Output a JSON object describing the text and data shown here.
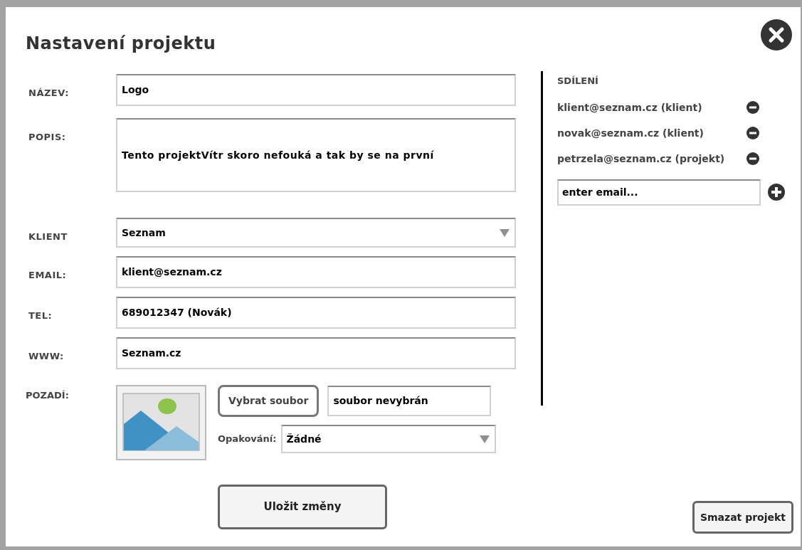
{
  "window": {
    "title": "Nastavení projektu"
  },
  "fields": [
    {
      "label": "NÁZEV:",
      "value": "Logo",
      "kind": "text"
    },
    {
      "label": "POPIS:",
      "value": "Tento projektVítr skoro nefouká a tak by se na první",
      "kind": "textarea"
    },
    {
      "label": "KLIENT",
      "value": "Seznam",
      "kind": "select"
    },
    {
      "label": "EMAIL:",
      "value": "klient@seznam.cz",
      "kind": "text"
    },
    {
      "label": "TEL:",
      "value": "689012347 (Novák)",
      "kind": "text"
    },
    {
      "label": "WWW:",
      "value": "Seznam.cz",
      "kind": "text"
    }
  ],
  "background": {
    "label": "POZADÍ:",
    "choose_button": "Vybrat soubor",
    "file_status": "soubor nevybrán",
    "repeat_label": "Opakování:",
    "repeat_value": "Žádné"
  },
  "save_button": "Uložit změny",
  "sharing": {
    "title": "SDÍLENÍ",
    "members": [
      {
        "text": "klient@seznam.cz (klient)"
      },
      {
        "text": "novak@seznam.cz (klient)"
      },
      {
        "text": "petrzela@seznam.cz (projekt)"
      }
    ],
    "placeholder": "enter email..."
  },
  "delete_button": "Smazat projekt"
}
